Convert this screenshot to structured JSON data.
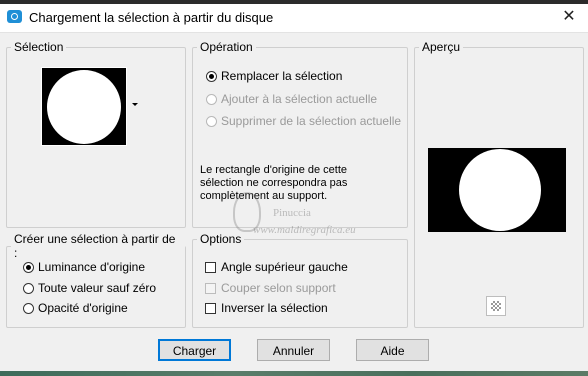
{
  "window": {
    "title": "Chargement la sélection à partir du disque",
    "close_glyph": "✕",
    "icon": "camera-icon"
  },
  "selection_group": {
    "legend": "Sélection",
    "thumbnail": "white circle on black"
  },
  "operation_group": {
    "legend": "Opération",
    "options": [
      {
        "label": "Remplacer la sélection",
        "checked": true,
        "enabled": true
      },
      {
        "label": "Ajouter à la sélection actuelle",
        "checked": false,
        "enabled": false
      },
      {
        "label": "Supprimer de la sélection actuelle",
        "checked": false,
        "enabled": false
      }
    ],
    "note": "Le rectangle d'origine de cette sélection ne correspondra pas complètement au support."
  },
  "preview_group": {
    "legend": "Aperçu"
  },
  "create_group": {
    "legend": "Créer une sélection à partir de :",
    "options": [
      {
        "label": "Luminance d'origine",
        "checked": true
      },
      {
        "label": "Toute valeur sauf zéro",
        "checked": false
      },
      {
        "label": "Opacité d'origine",
        "checked": false
      }
    ]
  },
  "options_group": {
    "legend": "Options",
    "checkboxes": [
      {
        "label": "Angle supérieur gauche",
        "checked": false,
        "enabled": true
      },
      {
        "label": "Couper selon support",
        "checked": false,
        "enabled": false
      },
      {
        "label": "Inverser la sélection",
        "checked": false,
        "enabled": true
      }
    ]
  },
  "buttons": {
    "ok": "Charger",
    "cancel": "Annuler",
    "help": "Aide"
  },
  "watermark": {
    "line1": "Pinuccia",
    "line2": "www.maldiregrafica.eu"
  }
}
